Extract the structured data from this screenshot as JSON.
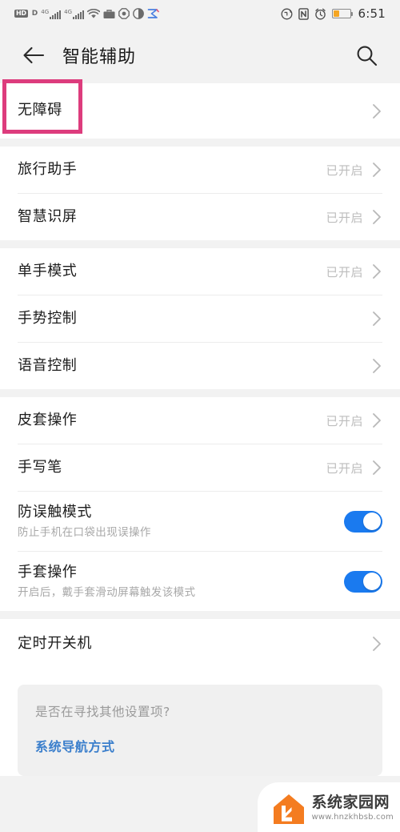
{
  "statusbar": {
    "left_icons": [
      "hd-volte-icon",
      "signal-4g-icon-1",
      "signal-4g-icon-2",
      "wifi-icon",
      "briefcase-work-icon",
      "octagon-icon",
      "contrast-icon",
      "share-arrow-icon"
    ],
    "hd_badge": "HD",
    "hd_suffix": "D",
    "network_label_1": "4G",
    "network_label_2": "4G",
    "right_icons": [
      "sync-rotate-icon",
      "nfc-icon",
      "alarm-clock-icon",
      "battery-icon"
    ],
    "battery_percent": 38,
    "battery_color": "#f5a623",
    "time": "6:51"
  },
  "header": {
    "back_icon": "back-arrow-icon",
    "title": "智能辅助",
    "search_icon": "search-icon"
  },
  "highlight": {
    "color": "#dd3c7d",
    "target": "无障碍"
  },
  "groups": [
    {
      "rows": [
        {
          "title": "无障碍",
          "subtitle": "",
          "value": "",
          "control": "chevron",
          "highlighted": true
        }
      ]
    },
    {
      "rows": [
        {
          "title": "旅行助手",
          "subtitle": "",
          "value": "已开启",
          "control": "chevron"
        },
        {
          "title": "智慧识屏",
          "subtitle": "",
          "value": "已开启",
          "control": "chevron"
        }
      ]
    },
    {
      "rows": [
        {
          "title": "单手模式",
          "subtitle": "",
          "value": "已开启",
          "control": "chevron"
        },
        {
          "title": "手势控制",
          "subtitle": "",
          "value": "",
          "control": "chevron"
        },
        {
          "title": "语音控制",
          "subtitle": "",
          "value": "",
          "control": "chevron"
        }
      ]
    },
    {
      "rows": [
        {
          "title": "皮套操作",
          "subtitle": "",
          "value": "已开启",
          "control": "chevron"
        },
        {
          "title": "手写笔",
          "subtitle": "",
          "value": "已开启",
          "control": "chevron"
        },
        {
          "title": "防误触模式",
          "subtitle": "防止手机在口袋出现误操作",
          "value": "",
          "control": "toggle",
          "toggle_on": true
        },
        {
          "title": "手套操作",
          "subtitle": "开启后，戴手套滑动屏幕触发该模式",
          "value": "",
          "control": "toggle",
          "toggle_on": true
        }
      ]
    },
    {
      "rows": [
        {
          "title": "定时开关机",
          "subtitle": "",
          "value": "",
          "control": "chevron"
        }
      ]
    }
  ],
  "footer": {
    "question": "是否在寻找其他设置项?",
    "link": "系统导航方式"
  },
  "watermark": {
    "logo_icon": "house-arrow-logo",
    "name": "系统家园网",
    "url": "www.hnzkhbsb.com",
    "accent": "#f47c20"
  },
  "toggle_on_color": "#1a7aef"
}
